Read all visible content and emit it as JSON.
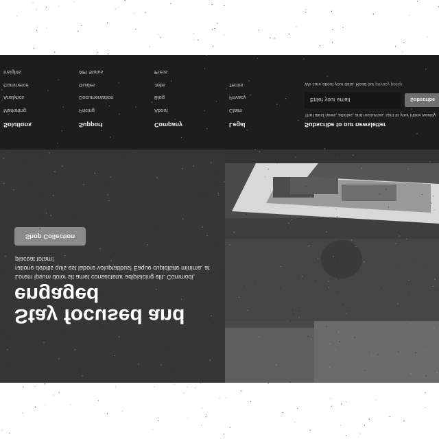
{
  "hero": {
    "title": "Stay focused and engaged",
    "description": "Lorem ipsum dolor sit amet consectetur adipisicing elit. Commodi, ratione debitis quis est labore voluptatibus! Eaque cupiditate minima, at placeat totam!",
    "button_label": "Shop Collection",
    "image_icon": "photo-icon"
  },
  "footer": {
    "columns": [
      {
        "title": "Solutions",
        "items": [
          "Marketing",
          "Analytics",
          "Commerce",
          "Insights"
        ]
      },
      {
        "title": "Support",
        "items": [
          "Pricing",
          "Documentation",
          "Guides",
          "API Status"
        ]
      },
      {
        "title": "Company",
        "items": [
          "About",
          "Blog",
          "Jobs",
          "Press"
        ]
      },
      {
        "title": "Legal",
        "items": [
          "Claim",
          "Privacy",
          "Terms"
        ]
      }
    ],
    "newsletter": {
      "title": "Subscribe to our newsletter",
      "text": "The latest news, articles, and resources, sent to your inbox weekly.",
      "email_placeholder": "Enter your email",
      "button_label": "Subscribe",
      "privacy_text": "We care about your data. Read our",
      "privacy_link": "privacy policy"
    }
  },
  "colors": {
    "hero_bg": "#363636",
    "footer_bg": "#1d1d1d",
    "button_bg": "#8a8a8a"
  }
}
